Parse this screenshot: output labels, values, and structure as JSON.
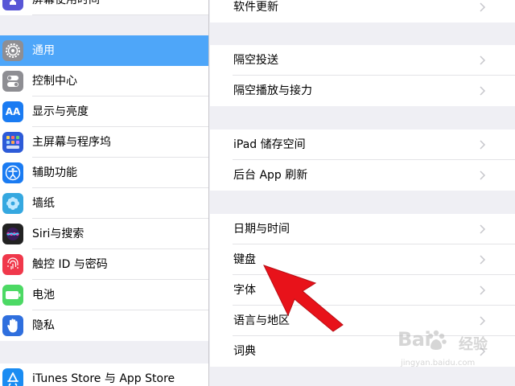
{
  "sidebar": {
    "items": [
      {
        "label": "屏幕使用时间",
        "icon": "hourglass-icon",
        "color": "#5856d6"
      },
      {
        "label": "通用",
        "icon": "gear-icon",
        "color": "#8e8e93",
        "selected": true
      },
      {
        "label": "控制中心",
        "icon": "toggles-icon",
        "color": "#8e8e93"
      },
      {
        "label": "显示与亮度",
        "icon": "aa-text-icon",
        "color": "#1a7bf2"
      },
      {
        "label": "主屏幕与程序坞",
        "icon": "app-grid-icon",
        "color": "#2d5bd8"
      },
      {
        "label": "辅助功能",
        "icon": "accessibility-icon",
        "color": "#1a7bf2"
      },
      {
        "label": "墙纸",
        "icon": "flower-icon",
        "color": "#35a8e0"
      },
      {
        "label": "Siri与搜索",
        "icon": "siri-icon",
        "color": "#222222"
      },
      {
        "label": "触控 ID 与密码",
        "icon": "fingerprint-icon",
        "color": "#f0384b"
      },
      {
        "label": "电池",
        "icon": "battery-icon",
        "color": "#4cd964"
      },
      {
        "label": "隐私",
        "icon": "hand-icon",
        "color": "#2f6fde"
      },
      {
        "label": "iTunes Store 与 App Store",
        "icon": "app-store-icon",
        "color": "#1a8cf2"
      }
    ]
  },
  "detail": {
    "items": [
      {
        "label": "软件更新"
      },
      {
        "label": "隔空投送"
      },
      {
        "label": "隔空播放与接力"
      },
      {
        "label": "iPad 储存空间"
      },
      {
        "label": "后台 App 刷新"
      },
      {
        "label": "日期与时间"
      },
      {
        "label": "键盘"
      },
      {
        "label": "字体"
      },
      {
        "label": "语言与地区"
      },
      {
        "label": "词典"
      }
    ]
  },
  "annotation": {
    "arrow_color": "#e8121a",
    "target": "键盘"
  },
  "watermark": {
    "logo_left": "Bai",
    "logo_right": "经验",
    "url": "jingyan.baidu.com"
  },
  "colors": {
    "accent": "#4ea6f9",
    "background": "#efeff4",
    "chevron": "#c7c7cc"
  }
}
